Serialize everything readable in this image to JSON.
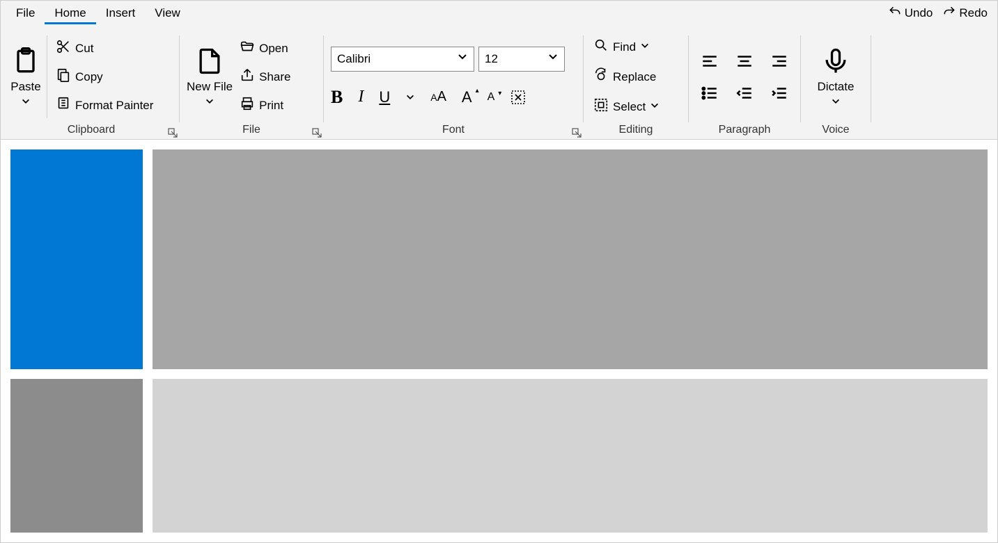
{
  "tabs": {
    "file": "File",
    "home": "Home",
    "insert": "Insert",
    "view": "View"
  },
  "undo": "Undo",
  "redo": "Redo",
  "clipboard": {
    "label": "Clipboard",
    "paste": "Paste",
    "cut": "Cut",
    "copy": "Copy",
    "format_painter": "Format Painter"
  },
  "file_group": {
    "label": "File",
    "new_file": "New File",
    "open": "Open",
    "share": "Share",
    "print": "Print"
  },
  "font_group": {
    "label": "Font",
    "font_name": "Calibri",
    "font_size": "12"
  },
  "editing": {
    "label": "Editing",
    "find": "Find",
    "replace": "Replace",
    "select": "Select"
  },
  "paragraph": {
    "label": "Paragraph"
  },
  "voice": {
    "label": "Voice",
    "dictate": "Dictate"
  }
}
